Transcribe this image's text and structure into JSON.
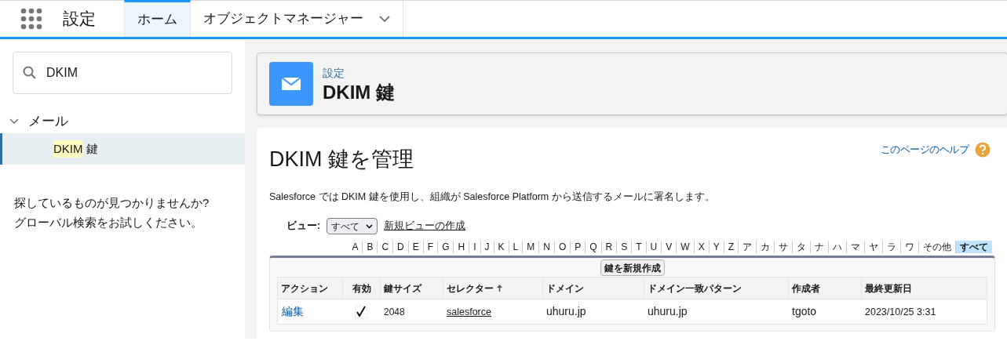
{
  "top_bar": {
    "app_title": "設定",
    "tabs": [
      {
        "label": "ホーム",
        "selected": true,
        "has_menu": false
      },
      {
        "label": "オブジェクトマネージャー",
        "selected": false,
        "has_menu": true
      }
    ]
  },
  "sidebar": {
    "search": {
      "value": "DKIM"
    },
    "tree": [
      {
        "label": "メール",
        "expanded": true,
        "children": [
          {
            "highlight": "DKIM",
            "rest": " 鍵",
            "selected": true
          }
        ]
      }
    ],
    "hint": [
      "探しているものが見つかりませんか?",
      "グローバル検索をお試しください。"
    ]
  },
  "header": {
    "breadcrumb": "設定",
    "title": "DKIM 鍵"
  },
  "content": {
    "title": "DKIM 鍵を管理",
    "help_link": "このページのヘルプ",
    "description": "Salesforce では DKIM 鍵を使用し、組織が Salesforce Platform から送信するメールに署名します。",
    "view_label": "ビュー:",
    "view_select": "すべて",
    "new_view_link": "新規ビューの作成",
    "letters": [
      {
        "label": "A",
        "selected": false
      },
      {
        "label": "B",
        "selected": false
      },
      {
        "label": "C",
        "selected": false
      },
      {
        "label": "D",
        "selected": false
      },
      {
        "label": "E",
        "selected": false
      },
      {
        "label": "F",
        "selected": false
      },
      {
        "label": "G",
        "selected": false
      },
      {
        "label": "H",
        "selected": false
      },
      {
        "label": "I",
        "selected": false
      },
      {
        "label": "J",
        "selected": false
      },
      {
        "label": "K",
        "selected": false
      },
      {
        "label": "L",
        "selected": false
      },
      {
        "label": "M",
        "selected": false
      },
      {
        "label": "N",
        "selected": false
      },
      {
        "label": "O",
        "selected": false
      },
      {
        "label": "P",
        "selected": false
      },
      {
        "label": "Q",
        "selected": false
      },
      {
        "label": "R",
        "selected": false
      },
      {
        "label": "S",
        "selected": false
      },
      {
        "label": "T",
        "selected": false
      },
      {
        "label": "U",
        "selected": false
      },
      {
        "label": "V",
        "selected": false
      },
      {
        "label": "W",
        "selected": false
      },
      {
        "label": "X",
        "selected": false
      },
      {
        "label": "Y",
        "selected": false
      },
      {
        "label": "Z",
        "selected": false
      },
      {
        "label": "ア",
        "selected": false
      },
      {
        "label": "カ",
        "selected": false
      },
      {
        "label": "サ",
        "selected": false
      },
      {
        "label": "タ",
        "selected": false
      },
      {
        "label": "ナ",
        "selected": false
      },
      {
        "label": "ハ",
        "selected": false
      },
      {
        "label": "マ",
        "selected": false
      },
      {
        "label": "ヤ",
        "selected": false
      },
      {
        "label": "ラ",
        "selected": false
      },
      {
        "label": "ワ",
        "selected": false
      },
      {
        "label": "その他",
        "selected": false
      },
      {
        "label": "すべて",
        "selected": true
      }
    ],
    "new_button": "鍵を新規作成",
    "table": {
      "columns": [
        {
          "label": "アクション",
          "sorted": false
        },
        {
          "label": "有効",
          "sorted": false
        },
        {
          "label": "鍵サイズ",
          "sorted": false
        },
        {
          "label": "セレクター",
          "sorted": true
        },
        {
          "label": "ドメイン",
          "sorted": false
        },
        {
          "label": "ドメイン一致パターン",
          "sorted": false
        },
        {
          "label": "作成者",
          "sorted": false
        },
        {
          "label": "最終更新日",
          "sorted": false
        }
      ],
      "rows": [
        {
          "action": "編集",
          "enabled": true,
          "key_size": "2048",
          "selector": "salesforce",
          "domain": "uhuru.jp",
          "domain_pattern": "uhuru.jp",
          "created_by": "tgoto",
          "modified": "2023/10/25 3:31"
        }
      ]
    }
  }
}
